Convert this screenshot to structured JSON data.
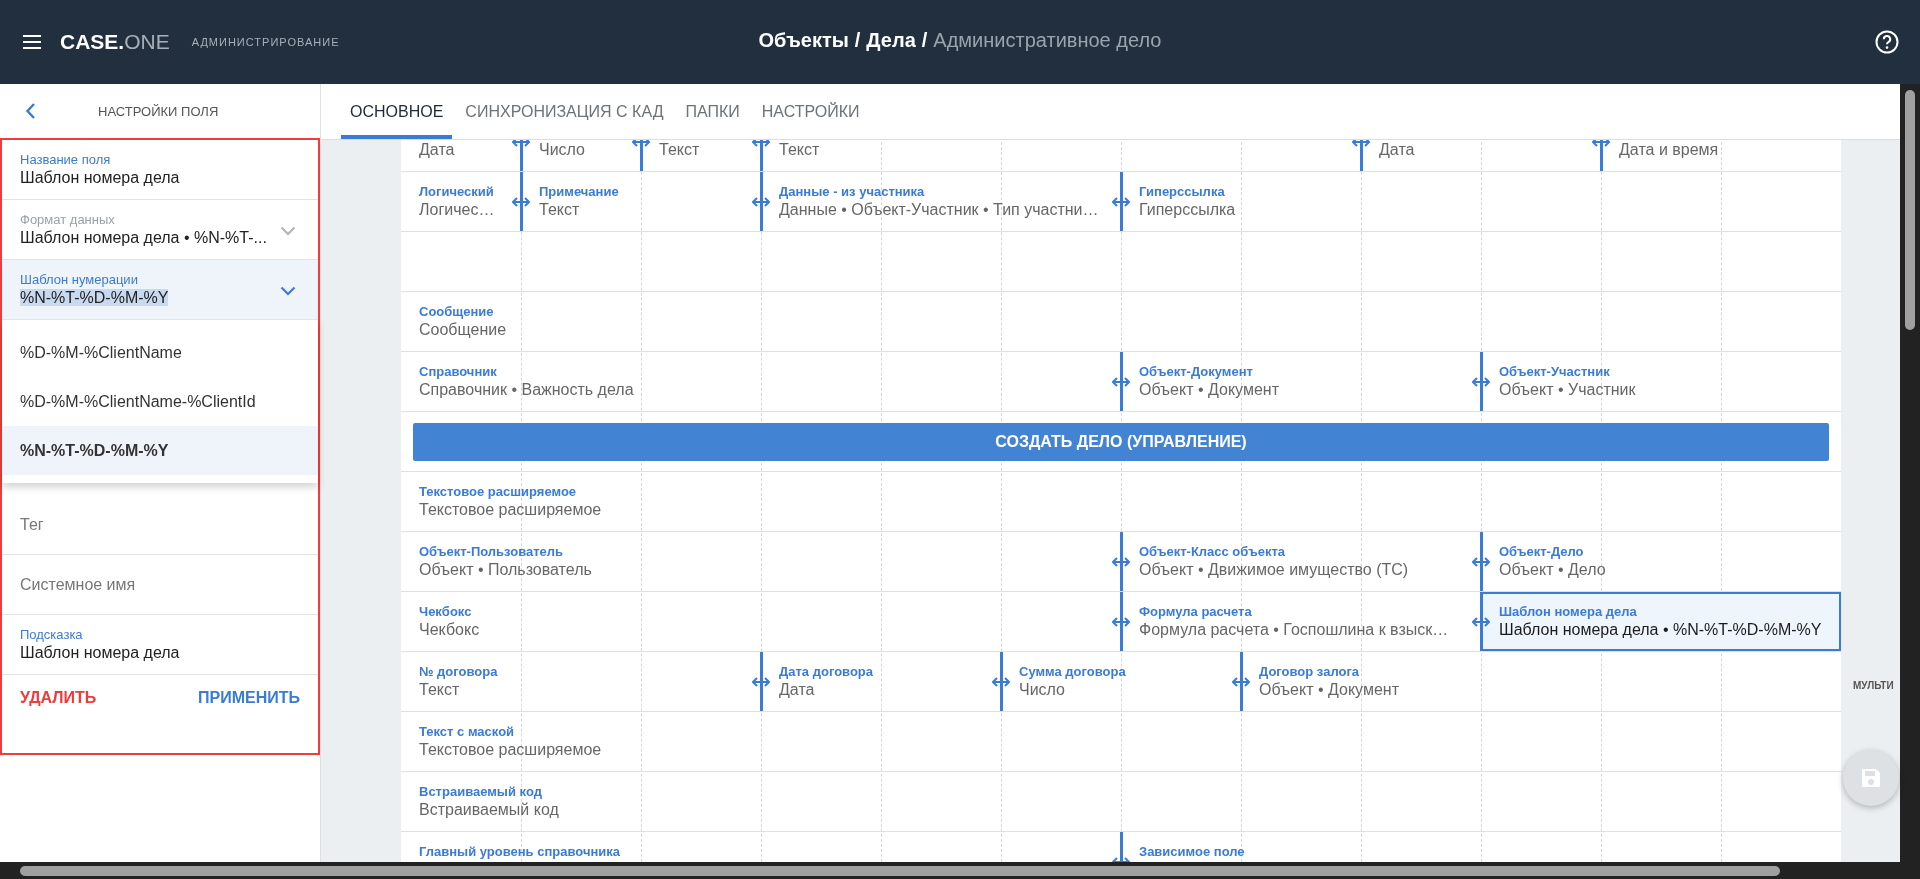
{
  "header": {
    "brand": {
      "main": "CASE.",
      "accent": "ONE"
    },
    "section": "АДМИНИСТРИРОВАНИЕ",
    "separator": "/",
    "breadcrumb": [
      {
        "label": "Объекты",
        "current": false
      },
      {
        "label": "Дела",
        "current": false
      },
      {
        "label": "Административное дело",
        "current": true
      }
    ]
  },
  "side_panel": {
    "title": "НАСТРОЙКИ ПОЛЯ",
    "fields": [
      {
        "kind": "text",
        "label": "Название поля",
        "value": "Шаблон номера дела"
      },
      {
        "kind": "select",
        "label": "Формат данных",
        "value": "Шаблон номера дела • %N-%T-...",
        "disabled": true,
        "expanded": false
      },
      {
        "kind": "select",
        "label": "Шаблон нумерации",
        "value": "%N-%T-%D-%M-%Y",
        "disabled": false,
        "expanded": true,
        "options": [
          {
            "label": "%D-%M-%ClientName",
            "selected": false
          },
          {
            "label": "%D-%M-%ClientName-%ClientId",
            "selected": false
          },
          {
            "label": "%N-%T-%D-%M-%Y",
            "selected": true
          }
        ]
      },
      {
        "kind": "text",
        "placeholder": "Тег"
      },
      {
        "kind": "text",
        "placeholder": "Системное имя"
      },
      {
        "kind": "text",
        "label": "Подсказка",
        "value": "Шаблон номера дела"
      }
    ],
    "actions": [
      {
        "label": "УДАЛИТЬ",
        "kind": "danger"
      },
      {
        "label": "ПРИМЕНИТЬ",
        "kind": "primary"
      }
    ]
  },
  "tabs": [
    {
      "label": "ОСНОВНОЕ",
      "selected": true
    },
    {
      "label": "СИНХРОНИЗАЦИЯ С КАД",
      "selected": false
    },
    {
      "label": "ПАПКИ",
      "selected": false
    },
    {
      "label": "НАСТРОЙКИ",
      "selected": false
    }
  ],
  "canvas": {
    "rows": [
      {
        "kind": "fields",
        "fields": [
          {
            "value": "Дата",
            "selected": false
          },
          {
            "value": "Число",
            "selected": false
          },
          {
            "value": "Текст",
            "selected": false
          },
          {
            "value": "Текст",
            "selected": false
          },
          {
            "value": "Дата",
            "selected": false
          },
          {
            "value": "Дата и время",
            "selected": false
          }
        ]
      },
      {
        "kind": "fields",
        "fields": [
          {
            "label": "Логический",
            "value": "Логичес…",
            "selected": false
          },
          {
            "label": "Примечание",
            "value": "Текст",
            "selected": false
          },
          {
            "label": "Данные - из участника",
            "value": "Данные • Объект-Участник • Тип участни…",
            "selected": false
          },
          {
            "label": "Гиперссылка",
            "value": "Гиперссылка",
            "selected": false
          }
        ]
      },
      {
        "kind": "empty"
      },
      {
        "kind": "fields",
        "fields": [
          {
            "label": "Сообщение",
            "value": "Сообщение",
            "selected": false
          }
        ]
      },
      {
        "kind": "fields",
        "fields": [
          {
            "label": "Справочник",
            "value": "Справочник • Важность дела",
            "selected": false
          },
          {
            "label": "Объект-Документ",
            "value": "Объект • Документ",
            "selected": false
          },
          {
            "label": "Объект-Участник",
            "value": "Объект • Участник",
            "selected": false
          }
        ]
      },
      {
        "kind": "button",
        "label": "СОЗДАТЬ ДЕЛО (УПРАВЛЕНИЕ)"
      },
      {
        "kind": "fields",
        "fields": [
          {
            "label": "Текстовое расширяемое",
            "value": "Текстовое расширяемое",
            "selected": false
          }
        ]
      },
      {
        "kind": "fields",
        "fields": [
          {
            "label": "Объект-Пользователь",
            "value": "Объект • Пользователь",
            "selected": false
          },
          {
            "label": "Объект-Класс объекта",
            "value": "Объект • Движимое имущество (ТС)",
            "selected": false
          },
          {
            "label": "Объект-Дело",
            "value": "Объект • Дело",
            "selected": false
          }
        ]
      },
      {
        "kind": "fields",
        "fields": [
          {
            "label": "Чекбокс",
            "value": "Чекбокс",
            "selected": false
          },
          {
            "label": "Формула расчета",
            "value": "Формула расчета • Госпошлина к взыск…",
            "selected": false
          },
          {
            "label": "Шаблон номера дела",
            "value": "Шаблон номера дела • %N-%T-%D-%M-%Y",
            "selected": true
          }
        ]
      },
      {
        "kind": "fields",
        "fields": [
          {
            "label": "№ договора",
            "value": "Текст",
            "selected": false
          },
          {
            "label": "Дата договора",
            "value": "Дата",
            "selected": false
          },
          {
            "label": "Сумма договора",
            "value": "Число",
            "selected": false
          },
          {
            "label": "Договор залога",
            "value": "Объект • Документ",
            "selected": false
          }
        ]
      },
      {
        "kind": "fields",
        "fields": [
          {
            "label": "Текст с маской",
            "value": "Текстовое расширяемое",
            "selected": false
          }
        ]
      },
      {
        "kind": "fields",
        "fields": [
          {
            "label": "Встраиваемый код",
            "value": "Встраиваемый код",
            "selected": false
          }
        ]
      },
      {
        "kind": "fields",
        "fields": [
          {
            "label": "Главный уровень справочника",
            "selected": false
          },
          {
            "label": "Зависимое поле",
            "selected": false
          }
        ]
      }
    ]
  },
  "side_label": "МУЛЬТИ"
}
